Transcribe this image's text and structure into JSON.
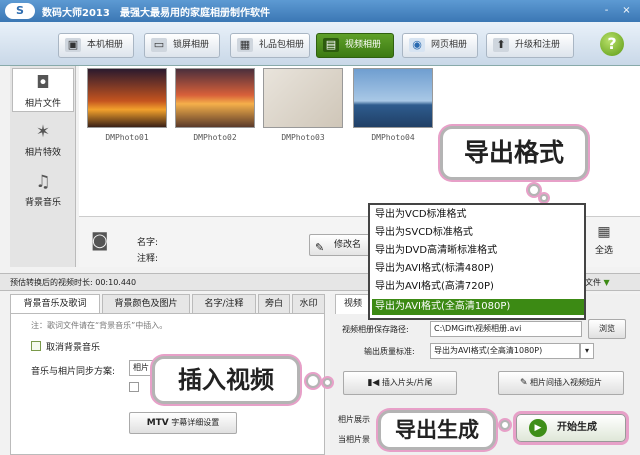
{
  "titlebar": {
    "logo": "S",
    "title": "数码大师2013",
    "slogan": "最强大最易用的家庭相册制作软件",
    "minimize": "-",
    "close": "×"
  },
  "tabs": [
    {
      "label": "本机相册",
      "icon": "photo-album-icon"
    },
    {
      "label": "锁屏相册",
      "icon": "monitor-icon"
    },
    {
      "label": "礼品包相册",
      "icon": "gift-icon"
    },
    {
      "label": "视频相册",
      "icon": "film-icon"
    },
    {
      "label": "网页相册",
      "icon": "globe-icon"
    },
    {
      "label": "升级和注册",
      "icon": "upgrade-icon"
    }
  ],
  "help": "?",
  "sidebar": {
    "items": [
      {
        "label": "相片文件",
        "icon": "camera-icon"
      },
      {
        "label": "相片特效",
        "icon": "sparkle-icon"
      },
      {
        "label": "背景音乐",
        "icon": "music-note-icon"
      }
    ]
  },
  "photos": [
    "DMPhoto01",
    "DMPhoto02",
    "DMPhoto03",
    "DMPhoto04"
  ],
  "detail": {
    "name_label": "名字:",
    "comment_label": "注释:",
    "modify_button": "修改名",
    "select_all": "全选"
  },
  "status": {
    "text": "预估转换后的视频时长: 00:10.440",
    "format_label": "文件"
  },
  "left_tabs": [
    "背景音乐及歌词",
    "背景颜色及图片",
    "名字/注释",
    "旁白",
    "水印"
  ],
  "left_panel": {
    "note": "注：歌词文件请在“背景音乐”中插入。",
    "cancel_music": "取消背景音乐",
    "sync_label": "音乐与相片同步方案:",
    "sync_value": "相片",
    "subtitle_button": "字幕详细设置",
    "mtv": "MTV"
  },
  "right_panel": {
    "tab": "视频",
    "path_label": "视频相册保存路径:",
    "path_value": "C:\\DMGift\\视频相册.avi",
    "browse": "浏览",
    "quality_label": "输出质量标准:",
    "quality_value": "导出为AVI格式(全高清1080P)",
    "insert_header": "插入片头/片尾",
    "insert_video": "相片间插入视频短片",
    "photo_show_label": "相片展示",
    "current_label": "当相片景"
  },
  "format_dropdown": {
    "options": [
      "导出为VCD标准格式",
      "导出为SVCD标准格式",
      "导出为DVD高清晰标准格式",
      "导出为AVI格式(标清480P)",
      "导出为AVI格式(高清720P)",
      "导出为AVI格式(全高清1080P)"
    ],
    "selected_index": 5
  },
  "callouts": {
    "export_format": "导出格式",
    "insert_video": "插入视频",
    "export_generate": "导出生成"
  },
  "start_button": "开始生成",
  "colors": {
    "accent_green": "#3c8a14",
    "title_blue": "#3b77b4",
    "callout_pink": "#e7a0c8"
  }
}
